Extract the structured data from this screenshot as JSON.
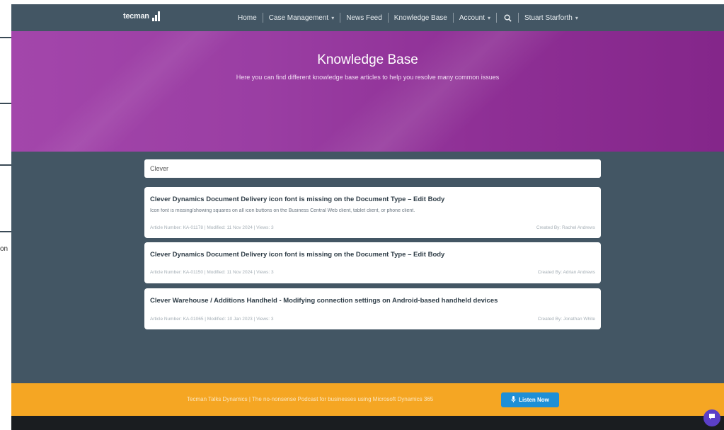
{
  "left_strip": {
    "text": "on"
  },
  "nav": {
    "logo_text": "tecman",
    "items": [
      {
        "label": "Home",
        "caret": false
      },
      {
        "label": "Case Management",
        "caret": true
      },
      {
        "label": "News Feed",
        "caret": false
      },
      {
        "label": "Knowledge Base",
        "caret": false
      },
      {
        "label": "Account",
        "caret": true
      }
    ],
    "user": "Stuart Starforth",
    "icons": {
      "search": "search-icon",
      "caret": "chevron-down-icon"
    }
  },
  "hero": {
    "title": "Knowledge Base",
    "subtitle": "Here you can find different knowledge base articles to help you resolve many common issues"
  },
  "search": {
    "value": "Clever"
  },
  "results": [
    {
      "title": "Clever Dynamics Document Delivery icon font is missing on the Document Type – Edit Body",
      "description": "Icon font is missing/showing squares on all icon buttons on the Business Central Web client, tablet client, or phone client.",
      "meta": "Article Number: KA-01178 | Modified: 11 Nov 2024 | Views: 3",
      "author": "Created By: Rachel Andrews"
    },
    {
      "title": "Clever Dynamics Document Delivery icon font is missing on the Document Type – Edit Body",
      "description": "",
      "meta": "Article Number: KA-01150 | Modified: 11 Nov 2024 | Views: 3",
      "author": "Created By: Adrian Andrews"
    },
    {
      "title": "Clever Warehouse / Additions Handheld - Modifying connection settings on Android-based handheld devices",
      "description": "",
      "meta": "Article Number: KA-01065 | Modified: 10 Jan 2023 | Views: 3",
      "author": "Created By: Jonathan White"
    }
  ],
  "banner": {
    "text": "Tecman Talks Dynamics | The no-nonsense Podcast for businesses using Microsoft Dynamics 365",
    "button_label": "Listen Now",
    "button_icon": "microphone-icon"
  },
  "colors": {
    "nav_bg": "#435664",
    "hero_start": "#a346ab",
    "hero_end": "#84268a",
    "banner": "#f5a623",
    "button": "#1e8fd6",
    "chat": "#5b3fc7"
  }
}
